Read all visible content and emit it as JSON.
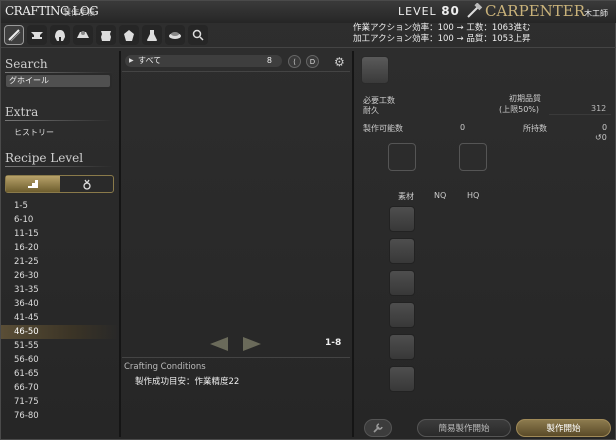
{
  "window": {
    "title": "CRAFTING LOG",
    "subtitle": "製作手帳"
  },
  "header": {
    "level_prefix": "LEVEL",
    "level_value": "80",
    "job_name": "CARPENTER",
    "job_name_jp": "木工師",
    "stat_line_1": "作業アクション効率：100 → 工数：1063進む",
    "stat_line_2": "加工アクション効率：100 → 品質：1053上昇"
  },
  "toolbar": {
    "tools": [
      {
        "icon": "saw-icon",
        "active": true
      },
      {
        "icon": "anvil-icon"
      },
      {
        "icon": "helmet-icon"
      },
      {
        "icon": "ring-icon"
      },
      {
        "icon": "leather-icon"
      },
      {
        "icon": "cloth-icon"
      },
      {
        "icon": "flask-icon"
      },
      {
        "icon": "cooking-icon"
      },
      {
        "icon": "search-icon"
      }
    ]
  },
  "sidebar": {
    "search_heading": "Search",
    "search_value": "グホイール",
    "extra_heading": "Extra",
    "history_label": "ヒストリー",
    "recipe_level_heading": "Recipe Level",
    "levels": [
      "1-5",
      "6-10",
      "11-15",
      "16-20",
      "21-25",
      "26-30",
      "31-35",
      "36-40",
      "41-45",
      "46-50",
      "51-55",
      "56-60",
      "61-65",
      "66-70",
      "71-75",
      "76-80"
    ],
    "selected_level": "46-50"
  },
  "recipe_list": {
    "filter_label": "すべて",
    "filter_count": "8",
    "page_range": "1-8",
    "conditions_title": "Crafting Conditions",
    "conditions_text": "製作成功目安：作業精度22"
  },
  "detail": {
    "progress_label": "必要工数",
    "durability_label": "耐久",
    "quality_label": "初期品質",
    "quality_cap": "(上限50%)",
    "quality_value": "312",
    "craftable_label": "製作可能数",
    "craftable_value": "0",
    "owned_label": "所持数",
    "owned_value": "0",
    "owned_sub": "0",
    "materials_label": "素材",
    "nq_label": "NQ",
    "hq_label": "HQ",
    "quick_synth_label": "簡易製作開始",
    "synthesize_label": "製作開始"
  },
  "colors": {
    "accent_gold": "#c9b27a",
    "selected_row": "#5a4e36",
    "start_button": "#8c7a4e"
  }
}
